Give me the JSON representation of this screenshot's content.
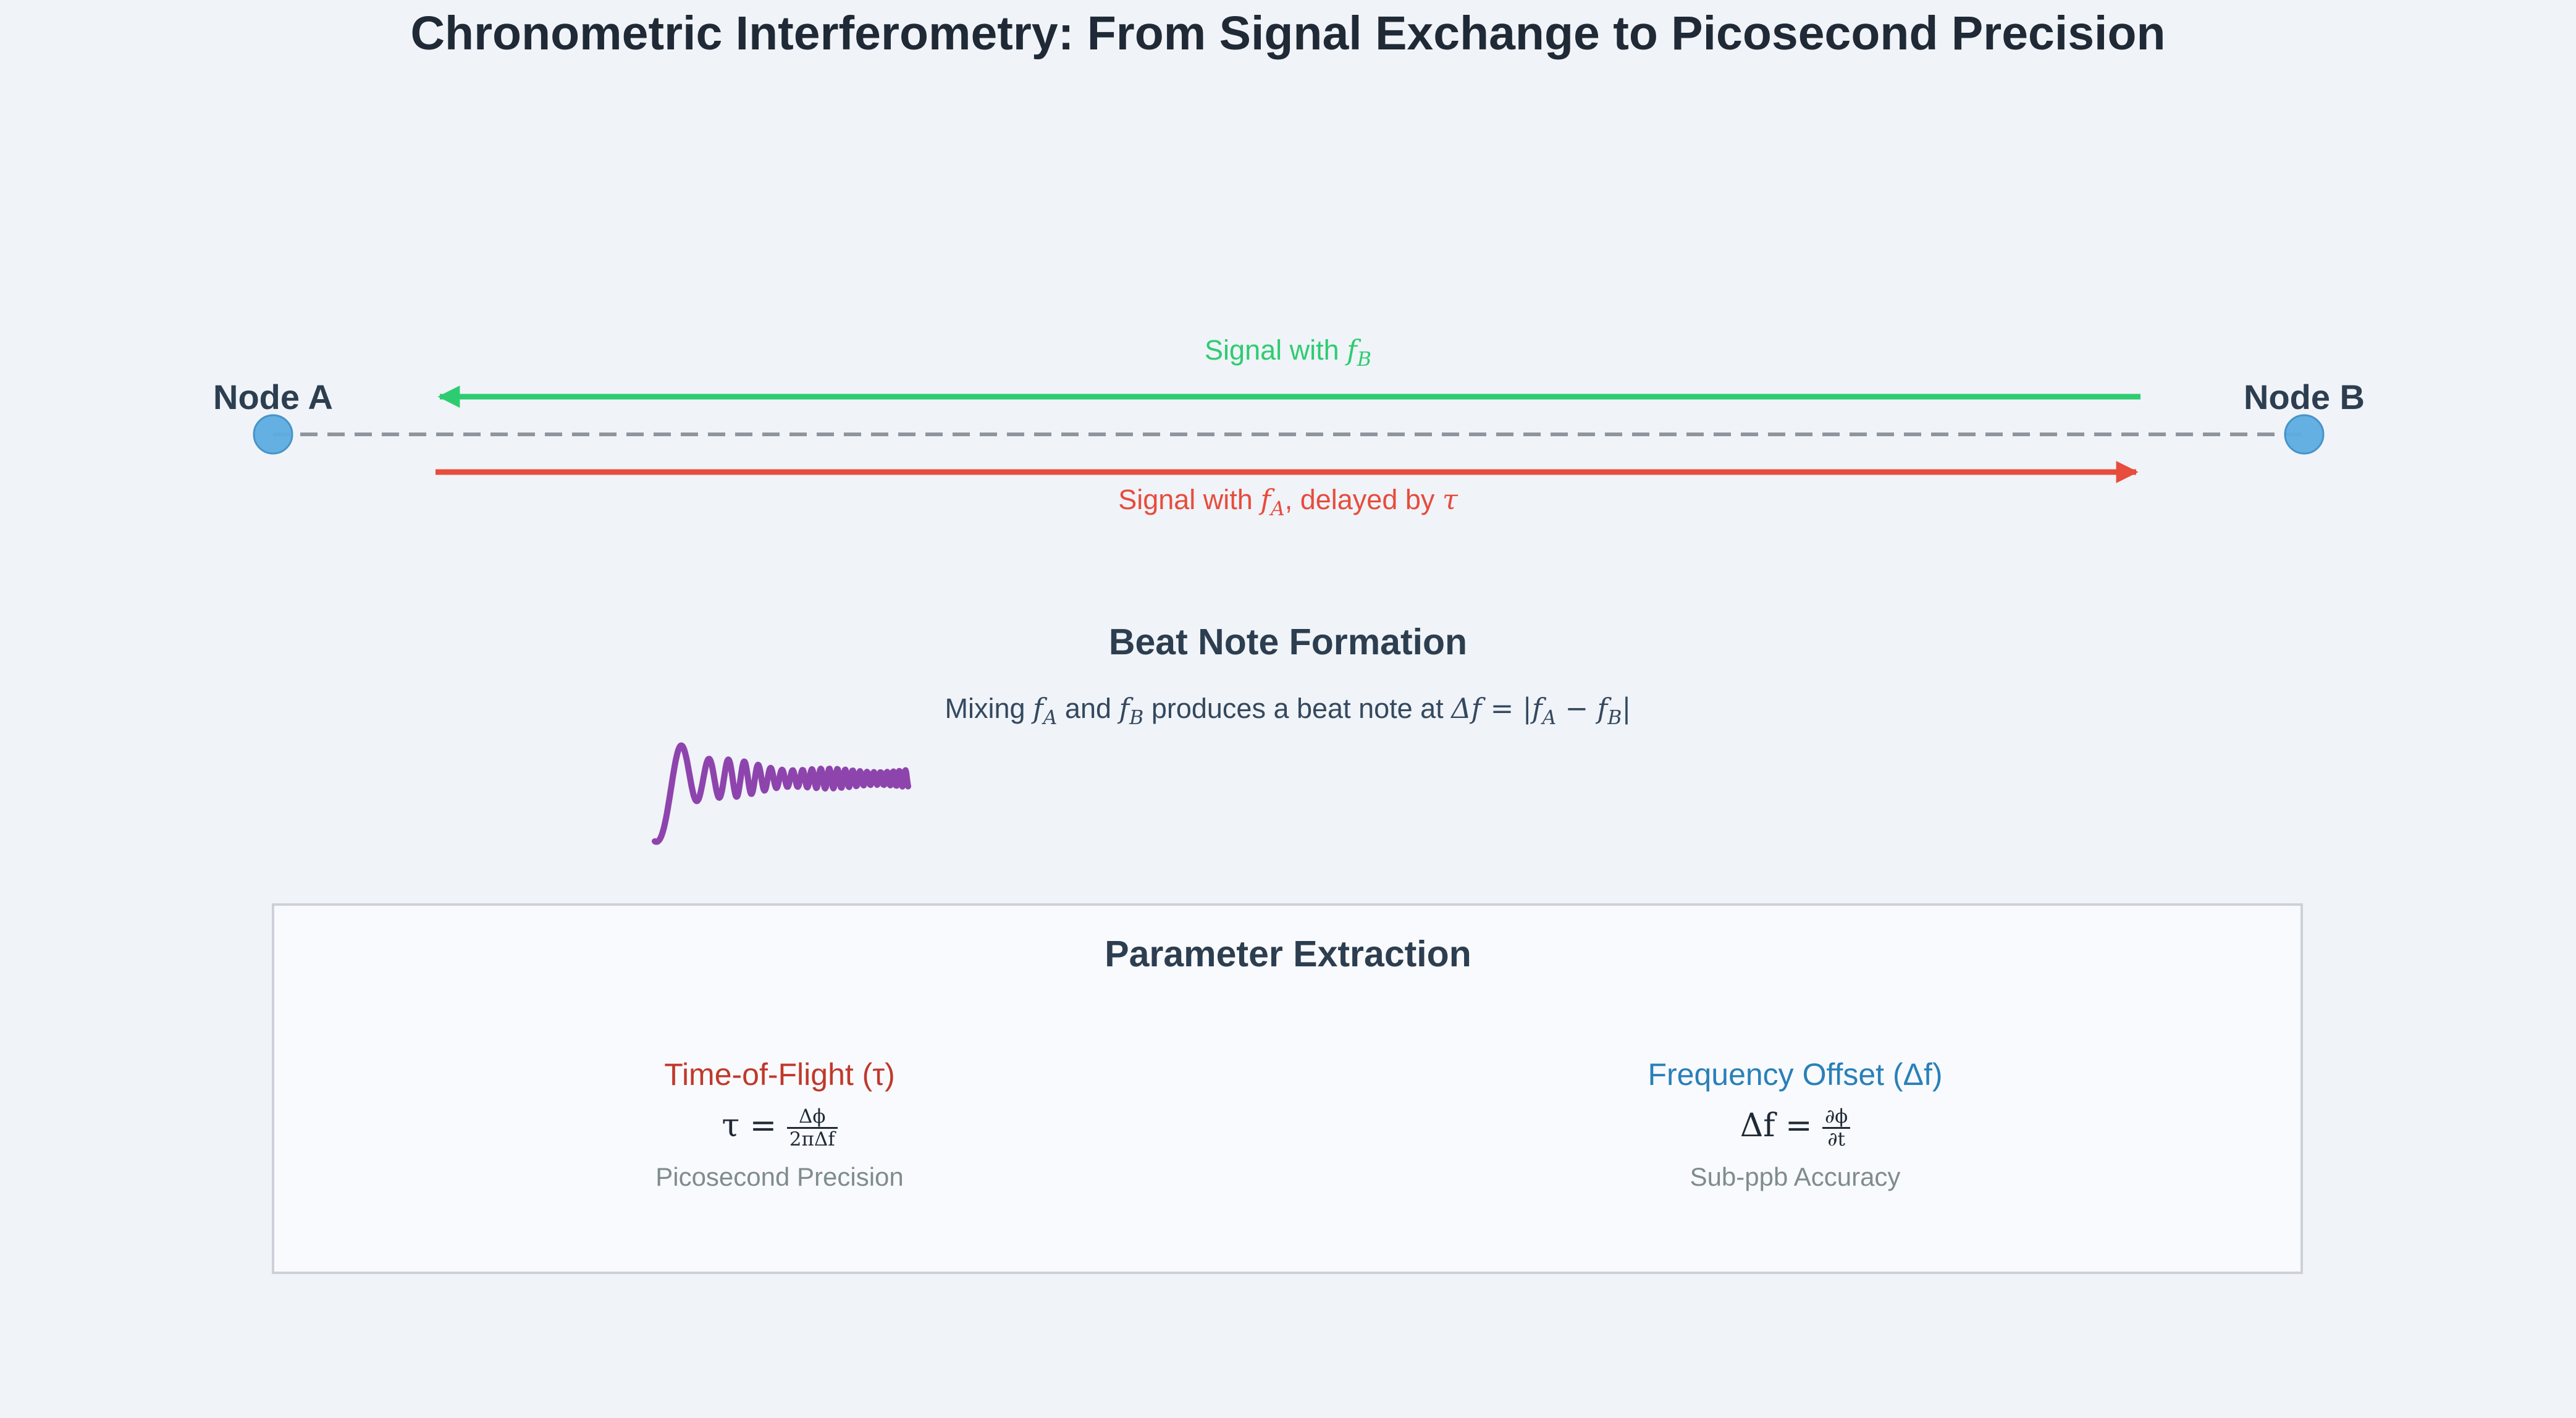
{
  "title": "Chronometric Interferometry: From Signal Exchange to Picosecond Precision",
  "nodes": {
    "a_label": "Node A",
    "b_label": "Node B"
  },
  "signals": {
    "upper_prefix": "Signal with ",
    "upper_var": "f",
    "upper_sub": "B",
    "lower_prefix": "Signal with ",
    "lower_var": "f",
    "lower_sub": "A",
    "lower_suffix": ", delayed by ",
    "lower_tau": "τ"
  },
  "beat": {
    "title": "Beat Note Formation",
    "desc_1": "Mixing ",
    "fa_var": "f",
    "fa_sub": "A",
    "desc_2": " and ",
    "fb_var": "f",
    "fb_sub": "B",
    "desc_3": " produces a beat note at ",
    "formula_prefix": "Δf = |f",
    "formula_sub_a": "A",
    "formula_mid": " − f",
    "formula_sub_b": "B",
    "formula_end": "|"
  },
  "params": {
    "title": "Parameter Extraction",
    "tof": {
      "heading": "Time-of-Flight (τ)",
      "lhs": "τ =",
      "num": "Δϕ",
      "den": "2πΔf",
      "caption": "Picosecond Precision"
    },
    "freq": {
      "heading": "Frequency Offset (Δf)",
      "lhs": "Δf =",
      "num": "∂ϕ",
      "den": "∂t",
      "caption": "Sub-ppb Accuracy"
    }
  },
  "colors": {
    "node": "#5dade2",
    "upper_signal": "#2ecc71",
    "lower_signal": "#e74c3c",
    "beat_wave": "#8e44ad",
    "tof_heading": "#c0392b",
    "freq_heading": "#2980b9"
  }
}
